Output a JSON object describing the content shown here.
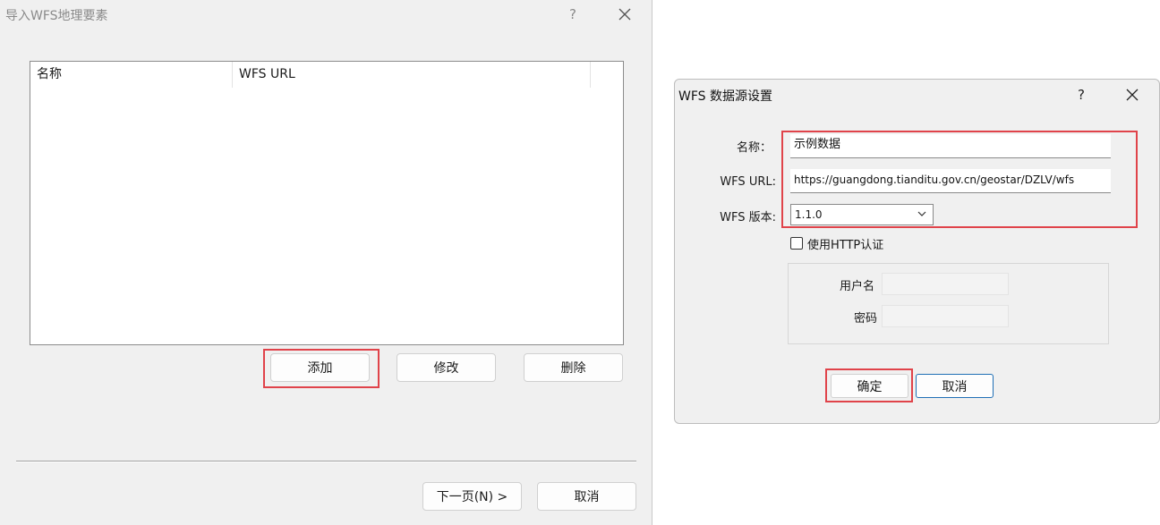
{
  "wizard": {
    "title": "导入WFS地理要素",
    "help": "?",
    "list": {
      "columns": [
        "名称",
        "WFS URL"
      ],
      "rows": []
    },
    "buttons": {
      "add": "添加",
      "modify": "修改",
      "delete": "删除",
      "next": "下一页(N) >",
      "cancel": "取消"
    }
  },
  "datasource": {
    "title": "WFS 数据源设置",
    "help": "?",
    "name_label": "名称：",
    "name_value": "示例数据",
    "url_label": "WFS URL:",
    "url_value": "https://guangdong.tianditu.gov.cn/geostar/DZLV/wfs",
    "version_label": "WFS 版本:",
    "version_value": "1.1.0",
    "http_auth_label": "使用HTTP认证",
    "http_auth_checked": false,
    "username_label": "用户名",
    "password_label": "密码",
    "ok": "确定",
    "cancel": "取消"
  },
  "colors": {
    "highlight": "#e0434a",
    "dialog_bg": "#f0f0f0",
    "focus_border": "#1f6fb5"
  }
}
